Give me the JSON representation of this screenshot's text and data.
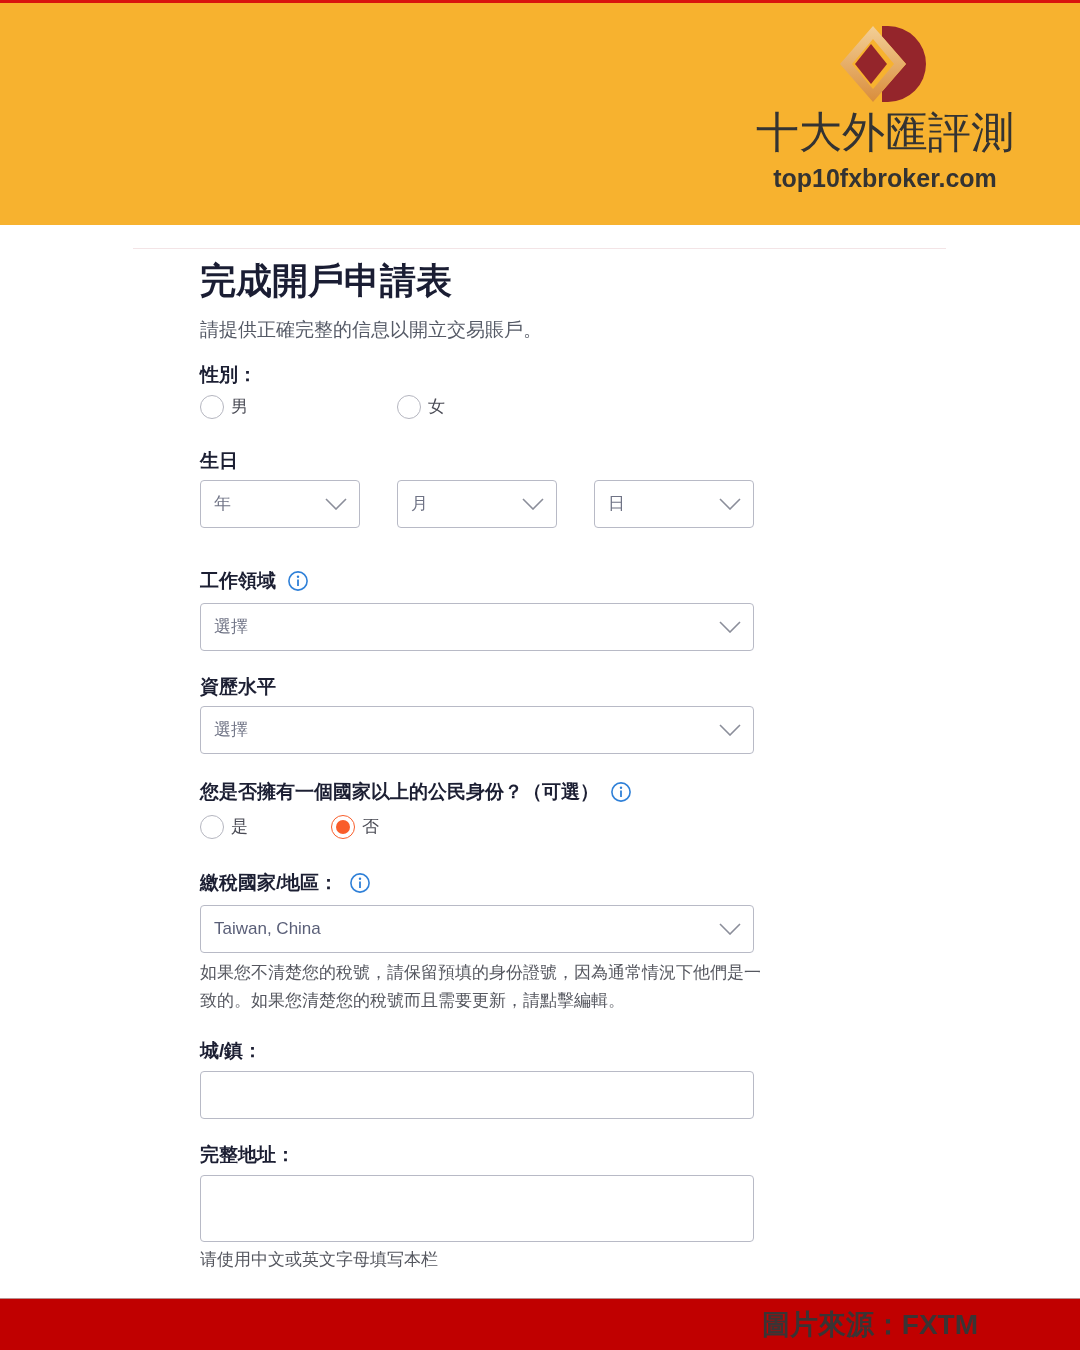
{
  "header": {
    "brand_name": "十大外匯評測",
    "domain": "top10fxbroker.com"
  },
  "form": {
    "title": "完成開戶申請表",
    "subtitle": "請提供正確完整的信息以開立交易賬戶。",
    "gender": {
      "label": "性別：",
      "options": [
        {
          "label": "男",
          "selected": false
        },
        {
          "label": "女",
          "selected": false
        }
      ]
    },
    "birthday": {
      "label": "生日",
      "selects": [
        {
          "placeholder": "年"
        },
        {
          "placeholder": "月"
        },
        {
          "placeholder": "日"
        }
      ]
    },
    "work_field": {
      "label": "工作領域",
      "info": true,
      "select": {
        "placeholder": "選擇"
      }
    },
    "experience_level": {
      "label": "資歷水平",
      "select": {
        "placeholder": "選擇"
      }
    },
    "dual_citizenship": {
      "label": "您是否擁有一個國家以上的公民身份？（可選）",
      "info": true,
      "options": [
        {
          "label": "是",
          "selected": false
        },
        {
          "label": "否",
          "selected": true
        }
      ]
    },
    "tax_country": {
      "label": "繳稅國家/地區：",
      "info": true,
      "select": {
        "value": "Taiwan, China"
      },
      "note": "如果您不清楚您的稅號，請保留預填的身份證號，因為通常情況下他們是一致的。如果您清楚您的稅號而且需要更新，請點擊編輯。"
    },
    "city": {
      "label": "城/鎮："
    },
    "address": {
      "label": "完整地址：",
      "note": "请使用中文或英文字母填写本栏"
    }
  },
  "footer": {
    "source": "圖片來源：FXTM"
  }
}
